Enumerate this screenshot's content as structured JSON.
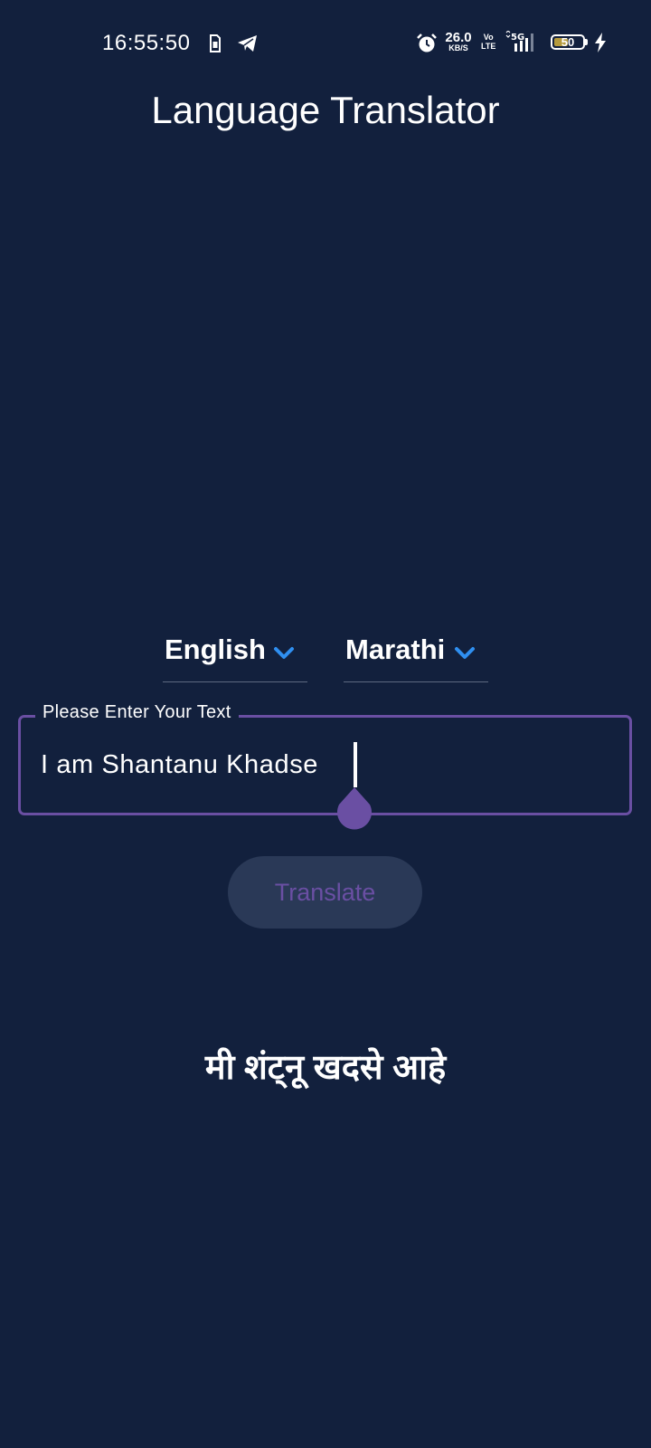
{
  "status_bar": {
    "time": "16:55:50",
    "net_speed_value": "26.0",
    "net_speed_unit": "KB/S",
    "volte_top": "Vo",
    "volte_bottom": "LTE",
    "network_type": "5G",
    "battery_level": "50",
    "battery_fraction": 0.5,
    "icons": [
      "sim-card-icon",
      "telegram-icon",
      "alarm-icon",
      "signal-icon",
      "battery-icon",
      "charging-bolt-icon"
    ]
  },
  "header": {
    "title": "Language Translator"
  },
  "languages": {
    "source": "English",
    "target": "Marathi"
  },
  "input": {
    "label": "Please Enter Your Text",
    "value": "I am Shantanu Khadse"
  },
  "actions": {
    "translate_label": "Translate"
  },
  "result": {
    "text": "मी शंट्नू खदसे आहे"
  },
  "colors": {
    "background": "#12203d",
    "accent_purple": "#6a4fa3",
    "chevron_blue": "#2f8ff0",
    "button_bg": "#2a3957",
    "text": "#ffffff"
  }
}
